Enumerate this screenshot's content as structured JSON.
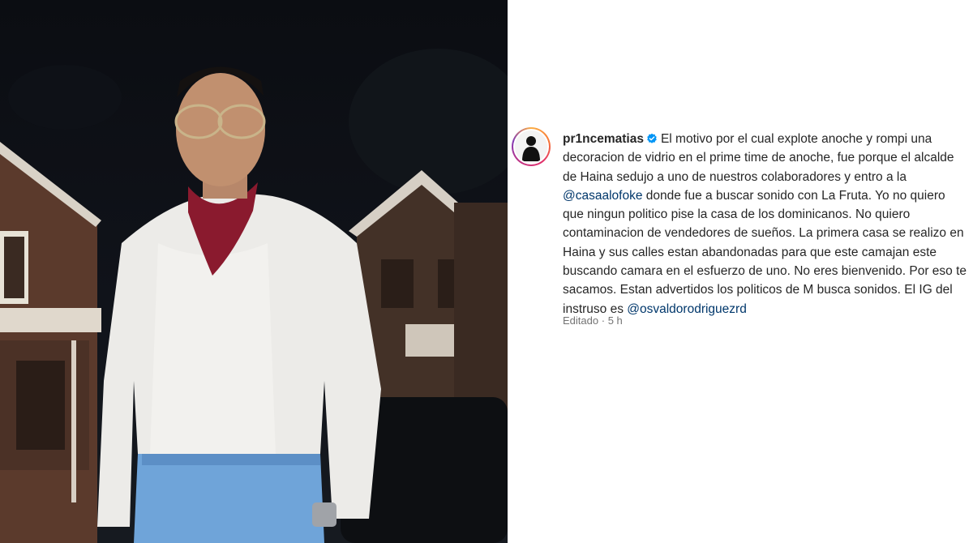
{
  "post": {
    "username": "pr1ncematias",
    "verified": true,
    "caption_parts": [
      "El motivo por el cual explote anoche y rompi una decoracion de vidrio en el prime time de anoche, fue porque el alcalde de Haina sedujo a uno de nuestros colaboradores y entro a la ",
      "@casaalofoke",
      " donde fue a buscar sonido con La Fruta. Yo no quiero que ningun politico pise la casa de los dominicanos. No quiero contaminacion de vendedores de sueños. La primera casa se realizo en Haina y sus calles estan abandonadas para que este camajan este buscando camara en el esfuerzo de uno. No eres bienvenido. Por eso te sacamos. Estan advertidos los politicos de M busca sonidos. El IG del instruso es ",
      "@osvaldorodriguezrd"
    ],
    "edited_label": "Editado",
    "separator": "·",
    "time_ago": "5 h"
  },
  "colors": {
    "mention": "#00376b",
    "verified": "#0095f6",
    "meta": "#737373"
  },
  "icons": {
    "verified": "verified-badge-icon",
    "avatar": "profile-avatar"
  }
}
